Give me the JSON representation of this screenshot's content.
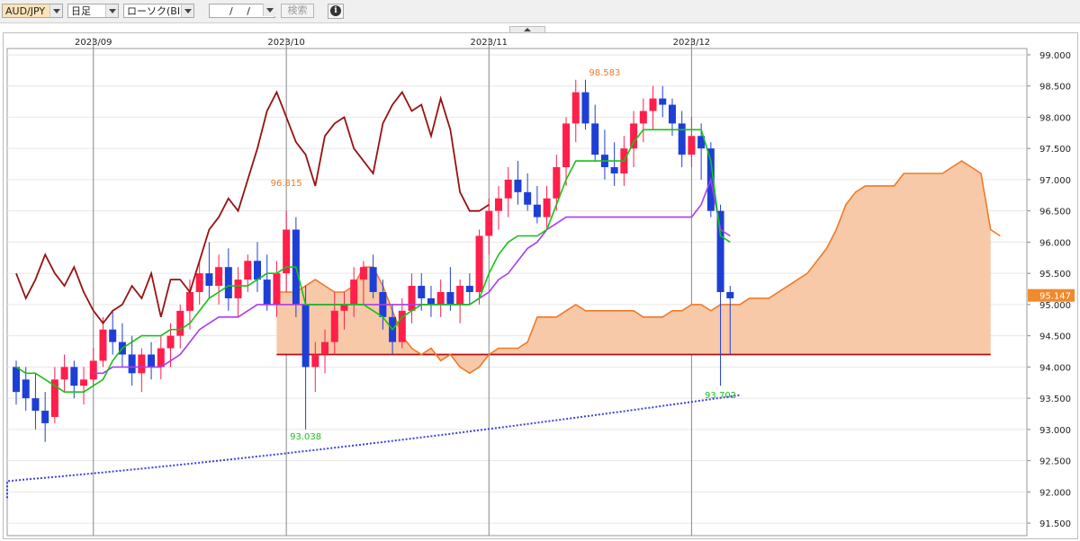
{
  "toolbar": {
    "symbol": "AUD/JPY",
    "period": "日足",
    "chart_type": "ローソク(BID)",
    "date_value": "/ /",
    "search_label": "検索",
    "info_icon": "info-icon"
  },
  "colors": {
    "bull_candle": "#ff1f4a",
    "bear_candle": "#1e3fd6",
    "conversion_line": "#18c018",
    "base_line": "#a93cf0",
    "lagging_span": "#991111",
    "span_a": "#f07a28",
    "span_b": "#b01010",
    "cloud_fill": "#f7c9a8",
    "ma200": "#4040e0",
    "current_price_bg": "#f08a2c"
  },
  "chart_data": {
    "type": "candlestick",
    "symbol": "AUD/JPY",
    "ylim": [
      91.3,
      99.1
    ],
    "y_ticks": [
      "99.000",
      "98.500",
      "98.000",
      "97.500",
      "97.000",
      "96.500",
      "96.000",
      "95.500",
      "95.000",
      "94.500",
      "94.000",
      "93.500",
      "93.000",
      "92.500",
      "92.000",
      "91.500"
    ],
    "x_ticks": [
      {
        "label": "2023/09",
        "index": 8
      },
      {
        "label": "2023/10",
        "index": 28
      },
      {
        "label": "2023/11",
        "index": 49
      },
      {
        "label": "2023/12",
        "index": 70
      }
    ],
    "current_price": "95.147",
    "annotations": [
      {
        "text": "98.583",
        "index": 61,
        "value": 98.583,
        "color": "#f07a28",
        "pos": "above"
      },
      {
        "text": "96.815",
        "index": 28,
        "value": 96.815,
        "color": "#f07a28",
        "pos": "above"
      },
      {
        "text": "93.038",
        "index": 30,
        "value": 93.038,
        "color": "#18c018",
        "pos": "below"
      },
      {
        "text": "93.702",
        "index": 73,
        "value": 93.702,
        "color": "#18c018",
        "pos": "below"
      }
    ],
    "candles_ohlc": [
      [
        94.0,
        94.1,
        93.4,
        93.6
      ],
      [
        93.8,
        94.0,
        93.3,
        93.5
      ],
      [
        93.5,
        93.9,
        93.0,
        93.3
      ],
      [
        93.3,
        93.6,
        92.8,
        93.1
      ],
      [
        93.2,
        94.0,
        93.1,
        93.8
      ],
      [
        93.8,
        94.2,
        93.6,
        94.0
      ],
      [
        94.0,
        94.1,
        93.5,
        93.7
      ],
      [
        93.7,
        94.0,
        93.4,
        93.8
      ],
      [
        93.8,
        94.3,
        93.7,
        94.1
      ],
      [
        94.1,
        94.8,
        94.0,
        94.6
      ],
      [
        94.6,
        94.9,
        94.2,
        94.4
      ],
      [
        94.4,
        94.7,
        94.0,
        94.2
      ],
      [
        94.2,
        94.5,
        93.7,
        93.9
      ],
      [
        93.9,
        94.3,
        93.6,
        94.2
      ],
      [
        94.2,
        94.4,
        93.8,
        94.0
      ],
      [
        94.0,
        94.5,
        93.8,
        94.3
      ],
      [
        94.3,
        94.7,
        94.0,
        94.5
      ],
      [
        94.5,
        95.0,
        94.3,
        94.9
      ],
      [
        94.9,
        95.4,
        94.6,
        95.2
      ],
      [
        95.2,
        95.7,
        95.0,
        95.5
      ],
      [
        95.5,
        96.0,
        95.1,
        95.3
      ],
      [
        95.3,
        95.8,
        95.0,
        95.6
      ],
      [
        95.6,
        95.9,
        94.9,
        95.1
      ],
      [
        95.1,
        95.6,
        94.8,
        95.4
      ],
      [
        95.4,
        95.8,
        95.2,
        95.7
      ],
      [
        95.7,
        96.0,
        95.2,
        95.4
      ],
      [
        95.4,
        95.8,
        94.9,
        95.0
      ],
      [
        95.0,
        95.7,
        94.8,
        95.5
      ],
      [
        95.5,
        96.5,
        95.2,
        96.2
      ],
      [
        96.2,
        96.4,
        94.8,
        95.0
      ],
      [
        95.0,
        95.3,
        93.0,
        94.0
      ],
      [
        94.0,
        94.4,
        93.6,
        94.2
      ],
      [
        94.2,
        94.6,
        93.9,
        94.4
      ],
      [
        94.4,
        95.2,
        94.2,
        94.9
      ],
      [
        94.9,
        95.2,
        94.6,
        95.0
      ],
      [
        95.0,
        95.6,
        94.8,
        95.4
      ],
      [
        95.4,
        95.7,
        95.0,
        95.6
      ],
      [
        95.6,
        95.8,
        95.1,
        95.2
      ],
      [
        95.2,
        95.4,
        94.6,
        94.8
      ],
      [
        94.8,
        95.0,
        94.2,
        94.4
      ],
      [
        94.4,
        95.1,
        94.3,
        94.9
      ],
      [
        94.9,
        95.5,
        94.7,
        95.3
      ],
      [
        95.3,
        95.5,
        94.9,
        95.1
      ],
      [
        95.1,
        95.3,
        94.8,
        95.0
      ],
      [
        95.0,
        95.4,
        94.8,
        95.2
      ],
      [
        95.2,
        95.6,
        94.9,
        95.0
      ],
      [
        95.0,
        95.4,
        94.7,
        95.3
      ],
      [
        95.3,
        95.5,
        95.0,
        95.2
      ],
      [
        95.2,
        96.2,
        95.0,
        96.1
      ],
      [
        96.1,
        96.7,
        95.8,
        96.5
      ],
      [
        96.5,
        96.9,
        96.2,
        96.7
      ],
      [
        96.7,
        97.2,
        96.4,
        97.0
      ],
      [
        97.0,
        97.3,
        96.6,
        96.8
      ],
      [
        96.8,
        97.1,
        96.5,
        96.6
      ],
      [
        96.6,
        96.9,
        96.3,
        96.4
      ],
      [
        96.4,
        96.9,
        96.2,
        96.7
      ],
      [
        96.7,
        97.4,
        96.5,
        97.2
      ],
      [
        97.2,
        98.0,
        96.9,
        97.9
      ],
      [
        97.9,
        98.6,
        97.6,
        98.4
      ],
      [
        98.4,
        98.6,
        97.8,
        97.9
      ],
      [
        97.9,
        98.2,
        97.3,
        97.4
      ],
      [
        97.4,
        97.8,
        97.0,
        97.2
      ],
      [
        97.2,
        97.6,
        96.9,
        97.1
      ],
      [
        97.1,
        97.7,
        96.9,
        97.5
      ],
      [
        97.5,
        98.1,
        97.2,
        97.9
      ],
      [
        97.9,
        98.3,
        97.6,
        98.1
      ],
      [
        98.1,
        98.5,
        97.8,
        98.3
      ],
      [
        98.3,
        98.5,
        98.0,
        98.2
      ],
      [
        98.2,
        98.3,
        97.7,
        97.9
      ],
      [
        97.9,
        98.1,
        97.2,
        97.4
      ],
      [
        97.4,
        98.0,
        97.2,
        97.7
      ],
      [
        97.7,
        97.9,
        97.0,
        97.5
      ],
      [
        97.5,
        97.6,
        96.4,
        96.5
      ],
      [
        96.5,
        96.6,
        93.7,
        95.2
      ],
      [
        95.2,
        95.3,
        94.2,
        95.1
      ]
    ],
    "series": [
      {
        "name": "",
        "key": "conversion",
        "values": [
          94.0,
          93.9,
          93.9,
          93.8,
          93.7,
          93.6,
          93.6,
          93.6,
          93.7,
          93.8,
          94.1,
          94.3,
          94.4,
          94.5,
          94.5,
          94.5,
          94.6,
          94.6,
          94.7,
          94.9,
          95.1,
          95.2,
          95.3,
          95.3,
          95.3,
          95.4,
          95.5,
          95.5,
          95.6,
          95.6,
          95.0,
          95.0,
          95.0,
          95.0,
          95.0,
          95.0,
          95.0,
          94.9,
          94.8,
          94.6,
          94.8,
          94.9,
          95.0,
          95.0,
          95.0,
          95.0,
          95.0,
          95.0,
          95.1,
          95.5,
          95.8,
          96.0,
          96.1,
          96.1,
          96.1,
          96.2,
          96.6,
          97.0,
          97.3,
          97.3,
          97.3,
          97.3,
          97.3,
          97.3,
          97.6,
          97.8,
          97.8,
          97.8,
          97.8,
          97.8,
          97.8,
          97.8,
          97.3,
          96.1,
          96.0
        ]
      },
      {
        "name": "",
        "key": "base",
        "values": [
          null,
          null,
          null,
          null,
          null,
          null,
          null,
          null,
          93.9,
          93.9,
          94.0,
          94.0,
          94.0,
          94.0,
          94.0,
          94.0,
          94.1,
          94.2,
          94.4,
          94.6,
          94.7,
          94.8,
          94.8,
          94.8,
          94.9,
          95.0,
          95.0,
          95.0,
          95.0,
          95.0,
          95.0,
          95.0,
          95.0,
          95.0,
          95.0,
          95.0,
          95.0,
          95.0,
          95.0,
          95.0,
          95.0,
          95.0,
          95.0,
          95.0,
          95.0,
          95.0,
          95.0,
          95.0,
          95.1,
          95.2,
          95.4,
          95.5,
          95.7,
          95.9,
          96.0,
          96.2,
          96.3,
          96.4,
          96.4,
          96.4,
          96.4,
          96.4,
          96.4,
          96.4,
          96.4,
          96.4,
          96.4,
          96.4,
          96.4,
          96.4,
          96.4,
          96.6,
          97.0,
          96.2,
          96.1
        ]
      },
      {
        "name": "",
        "key": "lagging",
        "values": [
          95.5,
          95.1,
          95.4,
          95.8,
          95.5,
          95.3,
          95.6,
          95.2,
          94.9,
          94.7,
          94.9,
          95.0,
          95.3,
          95.1,
          95.5,
          94.8,
          95.4,
          95.4,
          95.2,
          95.7,
          96.2,
          96.4,
          96.7,
          96.5,
          97.0,
          97.5,
          98.1,
          98.4,
          98.0,
          97.6,
          97.4,
          96.9,
          97.7,
          97.9,
          98.0,
          97.5,
          97.3,
          97.1,
          97.9,
          98.2,
          98.4,
          98.1,
          98.2,
          97.7,
          98.3,
          97.8,
          96.8,
          96.5,
          96.5,
          96.6
        ]
      },
      {
        "name": "",
        "key": "span_a",
        "values": [
          null,
          null,
          null,
          null,
          null,
          null,
          null,
          null,
          null,
          null,
          null,
          null,
          null,
          null,
          null,
          null,
          null,
          null,
          null,
          null,
          null,
          null,
          null,
          null,
          null,
          null,
          null,
          95.2,
          95.2,
          95.2,
          95.3,
          95.4,
          95.3,
          95.2,
          95.2,
          95.3,
          95.6,
          95.6,
          95.3,
          94.9,
          94.5,
          94.3,
          94.2,
          94.3,
          94.1,
          94.2,
          94.0,
          93.9,
          94.0,
          94.2,
          94.3,
          94.3,
          94.3,
          94.4,
          94.8,
          94.8,
          94.8,
          94.9,
          95.0,
          94.9,
          94.9,
          94.9,
          94.9,
          94.9,
          94.9,
          94.8,
          94.8,
          94.8,
          94.9,
          94.9,
          95.0,
          95.0,
          94.9,
          95.0,
          95.0,
          95.0,
          95.1,
          95.1,
          95.1,
          95.2,
          95.3,
          95.4,
          95.5,
          95.7,
          95.9,
          96.2,
          96.6,
          96.8,
          96.9,
          96.9,
          96.9,
          96.9,
          97.1,
          97.1,
          97.1,
          97.1,
          97.1,
          97.2,
          97.3,
          97.2,
          97.1,
          96.2,
          96.1
        ]
      },
      {
        "name": "",
        "key": "span_b",
        "values": [
          null,
          null,
          null,
          null,
          null,
          null,
          null,
          null,
          null,
          null,
          null,
          null,
          null,
          null,
          null,
          null,
          null,
          null,
          null,
          null,
          null,
          null,
          null,
          null,
          null,
          null,
          null,
          94.2,
          94.2,
          94.2,
          94.2,
          94.2,
          94.2,
          94.2,
          94.2,
          94.2,
          94.2,
          94.2,
          94.2,
          94.2,
          94.2,
          94.2,
          94.2,
          94.2,
          94.2,
          94.2,
          94.2,
          94.2,
          94.2,
          94.2,
          94.2,
          94.2,
          94.2,
          94.2,
          94.2,
          94.2,
          94.2,
          94.2,
          94.2,
          94.2,
          94.2,
          94.2,
          94.2,
          94.2,
          94.2,
          94.2,
          94.2,
          94.2,
          94.2,
          94.2,
          94.2,
          94.2,
          94.2,
          94.2,
          94.2,
          94.2,
          94.2,
          94.2,
          94.2,
          94.2,
          94.2,
          94.2,
          94.2,
          94.2,
          94.2,
          94.2,
          94.2,
          94.2,
          94.2,
          94.2,
          94.2,
          94.2,
          94.2,
          94.2,
          94.2,
          94.2,
          94.2,
          94.2,
          94.2,
          94.2,
          94.2,
          94.2
        ]
      },
      {
        "name": "",
        "key": "ma200",
        "start": 91.9,
        "end": 93.55
      }
    ]
  }
}
